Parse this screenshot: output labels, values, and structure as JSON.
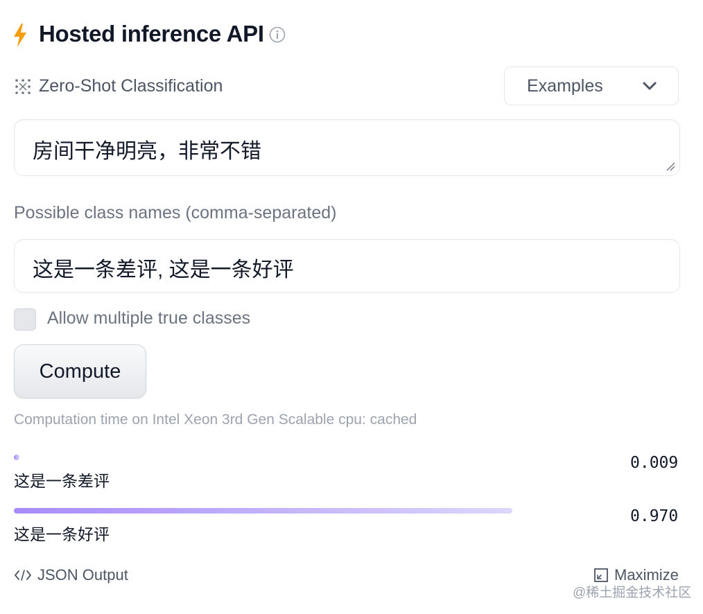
{
  "header": {
    "title": "Hosted inference API",
    "icon": "lightning-icon",
    "info_icon": "info-icon"
  },
  "task": {
    "label": "Zero-Shot Classification",
    "icon": "zero-shot-classification-icon"
  },
  "examples": {
    "label": "Examples",
    "icon": "chevron-down-icon"
  },
  "input": {
    "text": "房间干净明亮，非常不错"
  },
  "class_names": {
    "label": "Possible class names (comma-separated)",
    "value": "这是一条差评, 这是一条好评"
  },
  "multi_class": {
    "label": "Allow multiple true classes",
    "checked": false
  },
  "compute": {
    "label": "Compute"
  },
  "computation_time": "Computation time on Intel Xeon 3rd Gen Scalable cpu: cached",
  "results": [
    {
      "label": "这是一条差评",
      "score": "0.009",
      "fraction": 0.009
    },
    {
      "label": "这是一条好评",
      "score": "0.970",
      "fraction": 0.97
    }
  ],
  "footer": {
    "json_output": "JSON Output",
    "maximize": "Maximize"
  },
  "watermark": "@稀土掘金技术社区",
  "colors": {
    "accent_bolt": "#f59e0b",
    "bar_start": "#a78bfa",
    "bar_end": "#ddd6fe"
  }
}
